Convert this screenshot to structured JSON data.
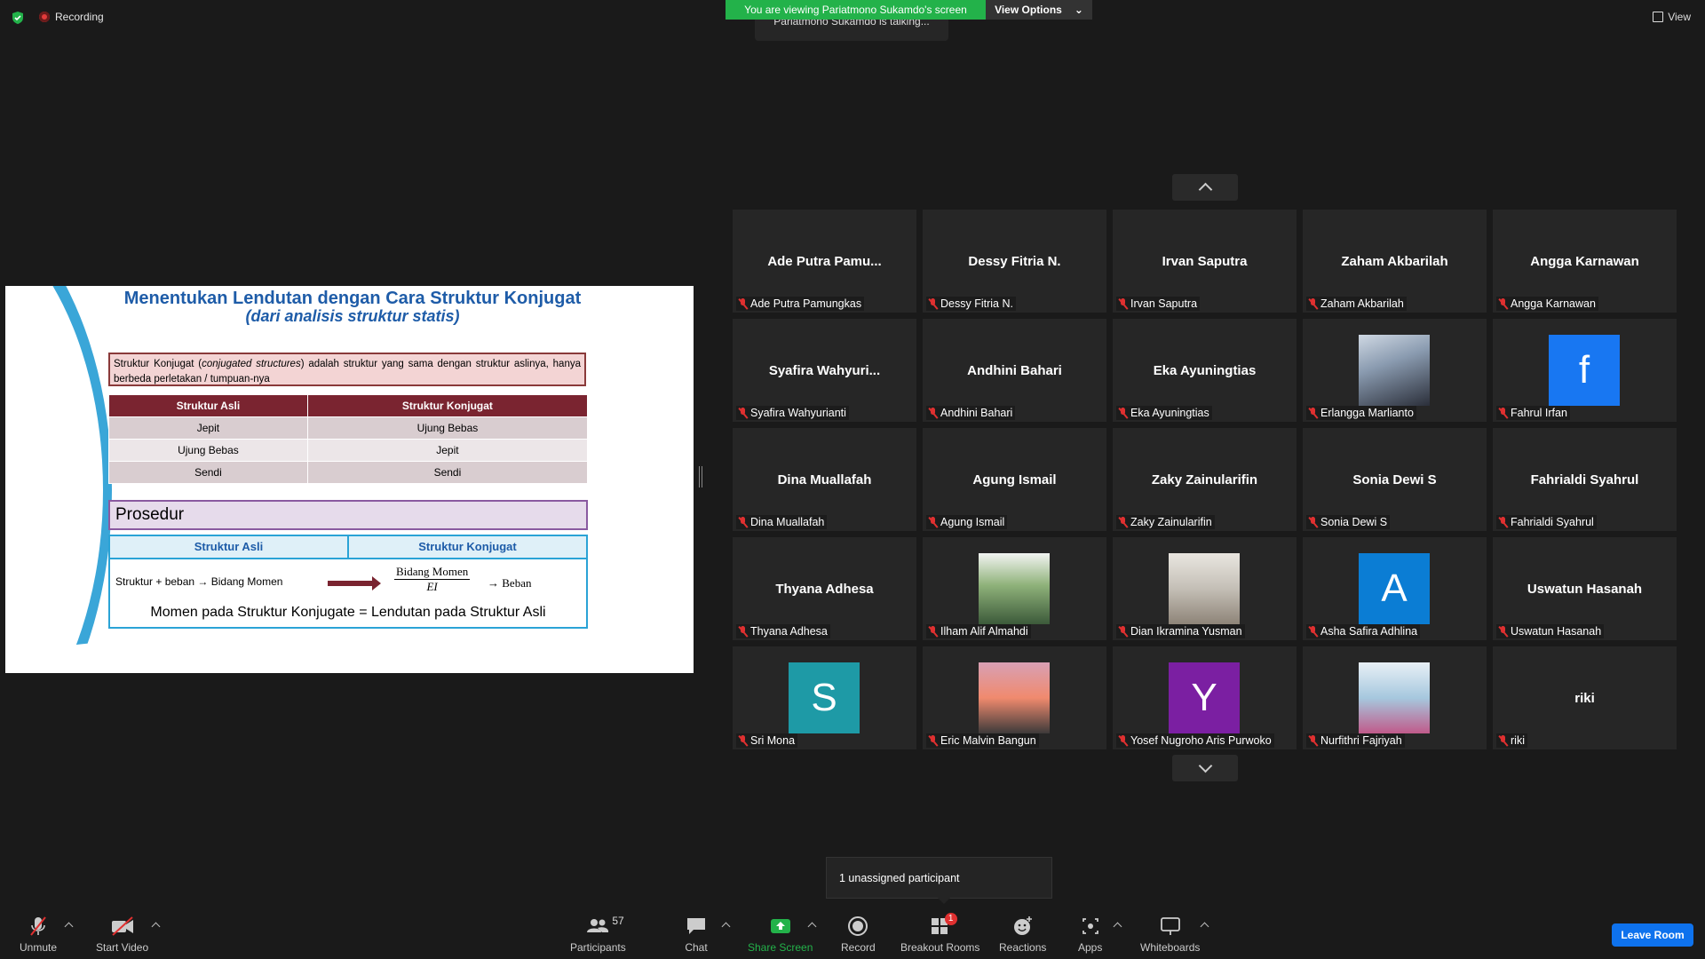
{
  "top": {
    "recording_label": "Recording",
    "viewing_banner": "You are viewing Pariatmono Sukamdo's screen",
    "view_options": "View Options",
    "talking": "Pariatmono Sukamdo is talking...",
    "view_label": "View"
  },
  "slide": {
    "title": "Menentukan Lendutan dengan Cara Struktur Konjugat",
    "subtitle": "(dari analisis struktur statis)",
    "definition_pre": "Struktur Konjugat (",
    "definition_italic": "conjugated structures",
    "definition_post": ") adalah struktur yang sama dengan struktur aslinya, hanya berbeda perletakan / tumpuan-nya",
    "table_headers": [
      "Struktur Asli",
      "Struktur Konjugat"
    ],
    "table_rows": [
      [
        "Jepit",
        "Ujung Bebas"
      ],
      [
        "Ujung Bebas",
        "Jepit"
      ],
      [
        "Sendi",
        "Sendi"
      ]
    ],
    "procedure_title": "Prosedur",
    "procedure_headers": [
      "Struktur Asli",
      "Struktur Konjugat"
    ],
    "procedure_left": "Struktur + beban → Bidang Momen",
    "procedure_numerator": "Bidang Momen",
    "procedure_denominator": "EI",
    "procedure_right": "→ Beban",
    "procedure_equation": "Momen pada Struktur Konjugate = Lendutan pada Struktur Asli"
  },
  "participants": [
    {
      "name": "Ade Putra Pamu...",
      "label": "Ade Putra Pamungkas"
    },
    {
      "name": "Dessy Fitria N.",
      "label": "Dessy Fitria N."
    },
    {
      "name": "Irvan Saputra",
      "label": "Irvan Saputra"
    },
    {
      "name": "Zaham Akbarilah",
      "label": "Zaham Akbarilah"
    },
    {
      "name": "Angga Karnawan",
      "label": "Angga Karnawan"
    },
    {
      "name": "Syafira  Wahyuri...",
      "label": "Syafira Wahyurianti"
    },
    {
      "name": "Andhini Bahari",
      "label": "Andhini Bahari"
    },
    {
      "name": "Eka Ayuningtias",
      "label": "Eka Ayuningtias"
    },
    {
      "name": "",
      "label": "Erlangga Marlianto",
      "photo": "photo-selfie"
    },
    {
      "name": "",
      "label": "Fahrul Irfan",
      "avatar": "f",
      "avatar_color": "#1877f2"
    },
    {
      "name": "Dina Muallafah",
      "label": "Dina Muallafah"
    },
    {
      "name": "Agung Ismail",
      "label": "Agung Ismail"
    },
    {
      "name": "Zaky Zainularifin",
      "label": "Zaky Zainularifin"
    },
    {
      "name": "Sonia Dewi S",
      "label": "Sonia Dewi S"
    },
    {
      "name": "Fahrialdi Syahrul",
      "label": "Fahrialdi Syahrul"
    },
    {
      "name": "Thyana Adhesa",
      "label": "Thyana Adhesa"
    },
    {
      "name": "",
      "label": "Ilham Alif Almahdi",
      "photo": "photo-outdoor"
    },
    {
      "name": "",
      "label": "Dian Ikramina Yusman",
      "photo": "photo-portrait"
    },
    {
      "name": "",
      "label": "Asha Safira Adhlina",
      "avatar": "A",
      "avatar_color": "#0b7dd4"
    },
    {
      "name": "Uswatun Hasanah",
      "label": "Uswatun Hasanah"
    },
    {
      "name": "",
      "label": "Sri Mona",
      "avatar": "S",
      "avatar_color": "#1e9aa6"
    },
    {
      "name": "",
      "label": "Eric Malvin Bangun",
      "photo": "photo-sunset"
    },
    {
      "name": "",
      "label": "Yosef Nugroho Aris Purwoko",
      "avatar": "Y",
      "avatar_color": "#7b1fa2"
    },
    {
      "name": "",
      "label": "Nurfithri Fajriyah",
      "photo": "photo-group"
    },
    {
      "name": "riki",
      "label": "riki"
    }
  ],
  "tooltip": "1 unassigned participant",
  "toolbar": {
    "unmute": "Unmute",
    "start_video": "Start Video",
    "participants": "Participants",
    "participants_count": "57",
    "chat": "Chat",
    "share_screen": "Share Screen",
    "record": "Record",
    "breakout_rooms": "Breakout Rooms",
    "breakout_badge": "1",
    "reactions": "Reactions",
    "apps": "Apps",
    "whiteboards": "Whiteboards",
    "leave": "Leave Room"
  },
  "colors": {
    "share_green": "#23b24a",
    "leave_blue": "#0e72ed",
    "muted_red": "#e03030"
  }
}
